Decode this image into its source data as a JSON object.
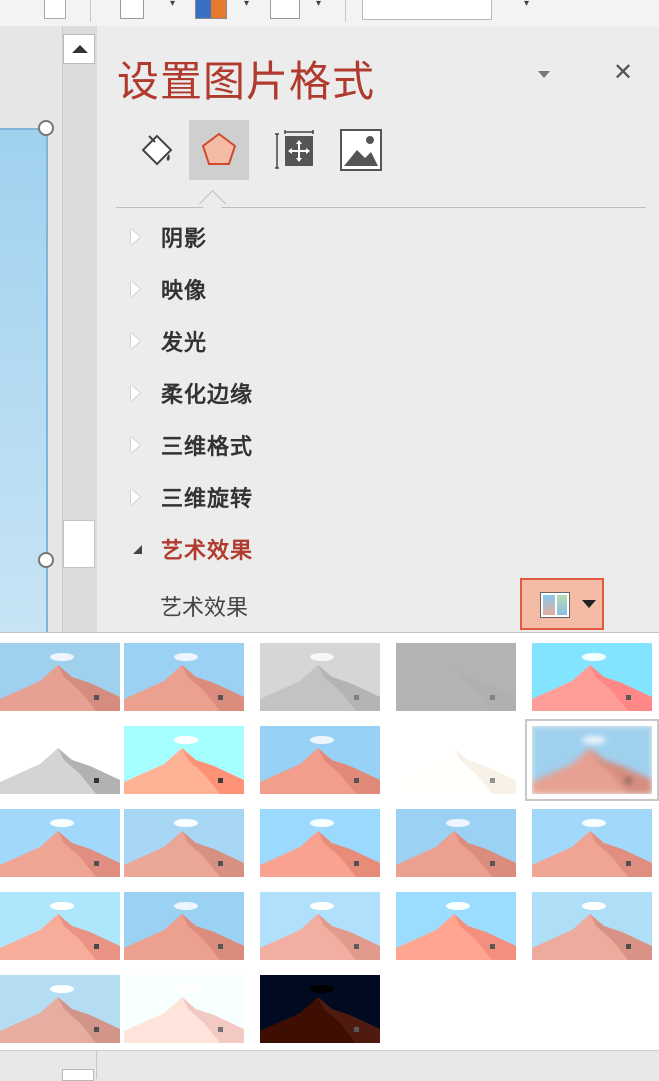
{
  "pane": {
    "title": "设置图片格式",
    "tabs": [
      {
        "name": "fill-line-icon"
      },
      {
        "name": "effects-icon"
      },
      {
        "name": "size-properties-icon"
      },
      {
        "name": "picture-icon"
      }
    ],
    "active_tab": "effects-icon",
    "sections": [
      {
        "label": "阴影",
        "expanded": false
      },
      {
        "label": "映像",
        "expanded": false
      },
      {
        "label": "发光",
        "expanded": false
      },
      {
        "label": "柔化边缘",
        "expanded": false
      },
      {
        "label": "三维格式",
        "expanded": false
      },
      {
        "label": "三维旋转",
        "expanded": false
      },
      {
        "label": "艺术效果",
        "expanded": true
      }
    ],
    "artistic_effect_label": "艺术效果"
  },
  "colors": {
    "title": "#b03a2e",
    "selected_button_bg": "#f4bca4",
    "selected_button_border": "#e05a3d",
    "sky": "#9fd0ee",
    "dune": "#e6a192"
  },
  "gallery": {
    "rows": 5,
    "columns": 5,
    "items": [
      {
        "effect": "none"
      },
      {
        "effect": "marker"
      },
      {
        "effect": "pencil-grayscale"
      },
      {
        "effect": "pencil-sketch"
      },
      {
        "effect": "line-drawing"
      },
      {
        "effect": "chalk-sketch"
      },
      {
        "effect": "paint-strokes"
      },
      {
        "effect": "paint-brush"
      },
      {
        "effect": "glow-diffused"
      },
      {
        "effect": "blur"
      },
      {
        "effect": "light-screen"
      },
      {
        "effect": "watercolor-sponge"
      },
      {
        "effect": "film-grain"
      },
      {
        "effect": "mosaic-bubbles"
      },
      {
        "effect": "glass"
      },
      {
        "effect": "cement"
      },
      {
        "effect": "texturizer"
      },
      {
        "effect": "crisscross-etching"
      },
      {
        "effect": "pastels-smooth"
      },
      {
        "effect": "plastic-wrap"
      },
      {
        "effect": "cutout"
      },
      {
        "effect": "photocopy"
      },
      {
        "effect": "glow-edges"
      }
    ],
    "selected_index": 9
  }
}
